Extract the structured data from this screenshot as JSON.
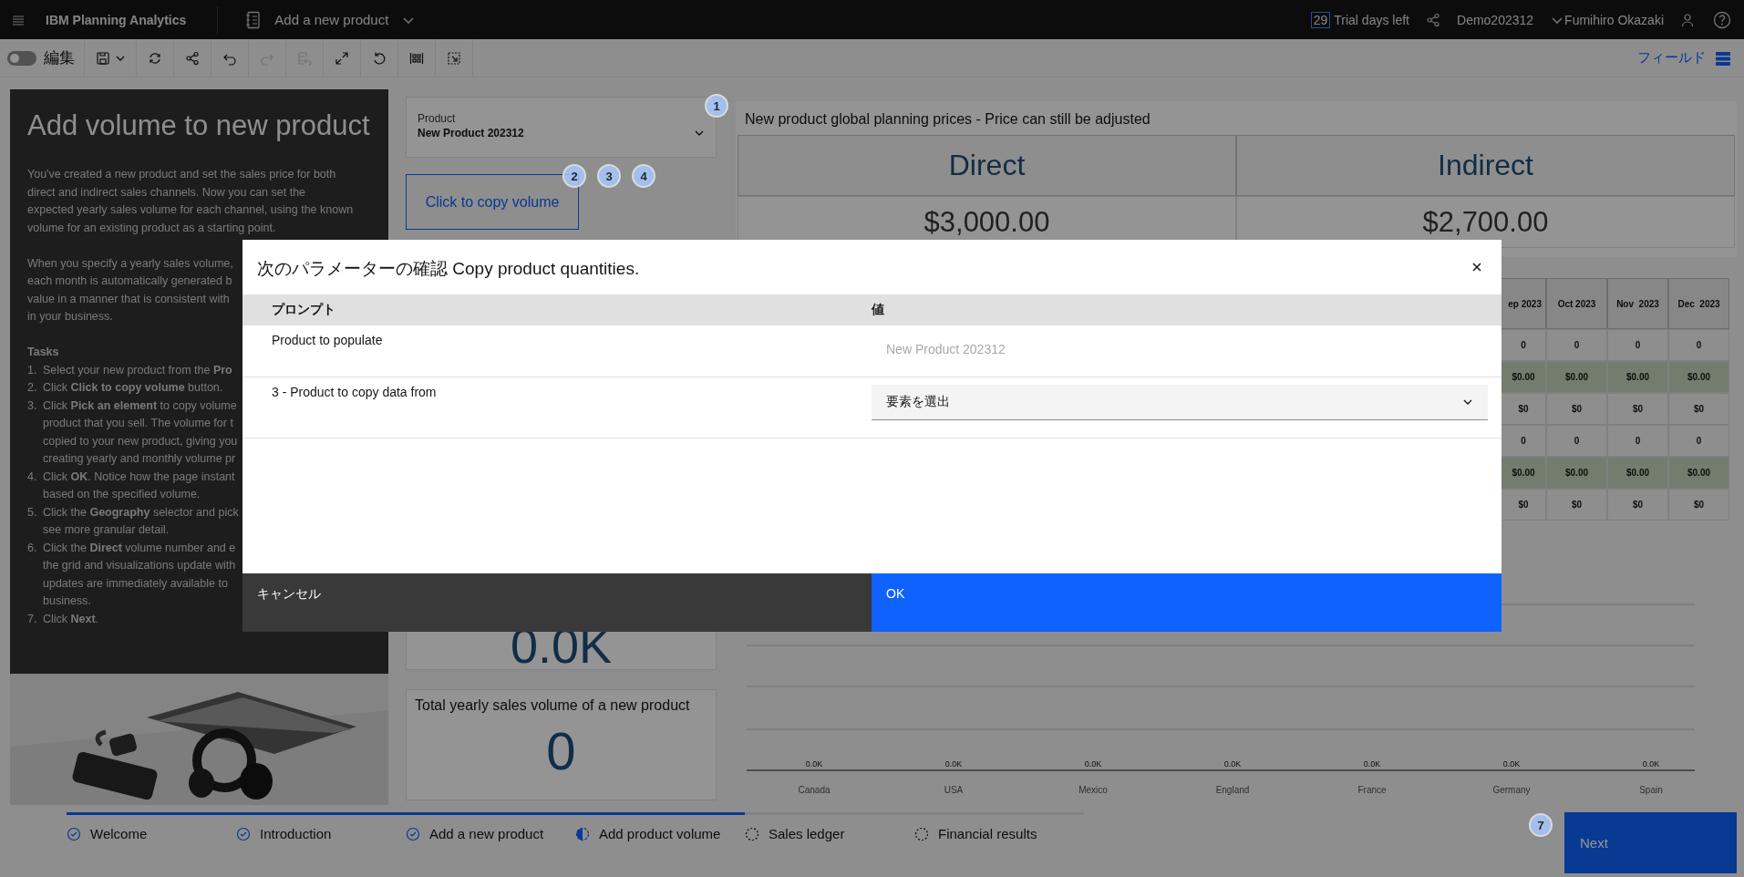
{
  "top_bar": {
    "app_name": "IBM Planning Analytics",
    "notebook": "Add a new product",
    "trial_days": "29",
    "trial_label": "Trial days left",
    "environment": "Demo202312",
    "user": "Fumihiro Okazaki"
  },
  "toolbar": {
    "edit_label": "編集",
    "edit_on": false,
    "fields_label": "フィールド",
    "tools": [
      {
        "kind": "save",
        "disabled": false
      },
      {
        "kind": "refresh",
        "disabled": false
      },
      {
        "kind": "share",
        "disabled": false
      },
      {
        "kind": "undo",
        "disabled": false
      },
      {
        "kind": "redo",
        "disabled": true
      },
      {
        "kind": "restore",
        "disabled": true
      },
      {
        "kind": "expand",
        "disabled": false
      },
      {
        "kind": "reset",
        "disabled": false
      },
      {
        "kind": "grid",
        "disabled": false
      },
      {
        "kind": "export",
        "disabled": false
      }
    ]
  },
  "guide": {
    "title": "Add volume to new product",
    "paragraphs": [
      [
        "You've created a new product and set the sales price for both",
        "direct and indirect sales channels. Now you can set the",
        "expected yearly sales volume for each channel, using the known",
        "volume for an existing product as a starting point."
      ],
      [
        "When you specify a yearly sales volume,",
        "each month is automatically generated b",
        "value in a manner that is consistent with",
        "in your business."
      ]
    ],
    "tasks_heading": "Tasks",
    "tasks": [
      {
        "number": "1.",
        "lines": [
          "Select your new product from the **Pro**"
        ]
      },
      {
        "number": "2.",
        "lines": [
          "Click **Click to copy volume** button."
        ]
      },
      {
        "number": "3.",
        "lines": [
          "Click **Pick an element** to copy volume",
          "product that you sell. The volume for t",
          "copied to your new product, giving you",
          "creating yearly and monthly volume pr"
        ]
      },
      {
        "number": "4.",
        "lines": [
          "Click **OK**. Notice how the page instant",
          "based on the specified volume."
        ]
      },
      {
        "number": "5.",
        "lines": [
          "Click the **Geography** selector and pick",
          "see more granular detail."
        ]
      },
      {
        "number": "6.",
        "lines": [
          "Click the **Direct** volume number and e",
          "the grid and visualizations update with",
          "updates are immediately available to",
          "business."
        ]
      },
      {
        "number": "7.",
        "lines": [
          "Click **Next**."
        ]
      }
    ]
  },
  "product_selector": {
    "label": "Product",
    "value": "New Product 202312"
  },
  "copy_button": "Click to copy volume",
  "volume_card": {
    "value": "0.0K"
  },
  "total_card": {
    "title": "Total yearly sales volume of a new product",
    "value": "0"
  },
  "prices": {
    "title": "New product global planning prices - Price can still be adjusted",
    "columns": [
      "Direct",
      "Indirect"
    ],
    "values": [
      "$3,000.00",
      "$2,700.00"
    ]
  },
  "monthly_grid": {
    "columns": [
      "ep 2023",
      "Oct 2023",
      "Nov  2023",
      "Dec  2023"
    ],
    "rows": [
      {
        "highlighted": false,
        "cells": [
          "0",
          "0",
          "0",
          "0"
        ]
      },
      {
        "highlighted": true,
        "cells": [
          "$0.00",
          "$0.00",
          "$0.00",
          "$0.00"
        ]
      },
      {
        "highlighted": false,
        "cells": [
          "$0",
          "$0",
          "$0",
          "$0"
        ]
      },
      {
        "highlighted": false,
        "cells": [
          "0",
          "0",
          "0",
          "0"
        ]
      },
      {
        "highlighted": true,
        "cells": [
          "$0.00",
          "$0.00",
          "$0.00",
          "$0.00"
        ]
      },
      {
        "highlighted": false,
        "cells": [
          "$0",
          "$0",
          "$0",
          "$0"
        ]
      }
    ]
  },
  "chart": {
    "categories": [
      "Canada",
      "USA",
      "Mexico",
      "England",
      "France",
      "Germany",
      "Spain"
    ],
    "value_labels": [
      "0.0K",
      "0.0K",
      "0.0K",
      "0.0K",
      "0.0K",
      "0.0K",
      "0.0K"
    ]
  },
  "badges": [
    "1",
    "2",
    "3",
    "4",
    "7"
  ],
  "steps": [
    {
      "label": "Welcome",
      "kind": "complete"
    },
    {
      "label": "Introduction",
      "kind": "complete"
    },
    {
      "label": "Add a new product",
      "kind": "complete"
    },
    {
      "label": "Add product volume",
      "kind": "current"
    },
    {
      "label": "Sales ledger",
      "kind": "incomplete"
    },
    {
      "label": "Financial results",
      "kind": "incomplete"
    }
  ],
  "next_button": "Next",
  "dialog": {
    "title": "次のパラメーターの確認 Copy product quantities.",
    "columns": [
      "プロンプト",
      "値"
    ],
    "rows": [
      {
        "kind": "readonly",
        "prompt": "Product to populate",
        "value": "New Product 202312"
      },
      {
        "kind": "select",
        "prompt": "3 - Product to copy data from",
        "placeholder": "要素を選出"
      }
    ],
    "cancel": "キャンセル",
    "ok": "OK"
  }
}
